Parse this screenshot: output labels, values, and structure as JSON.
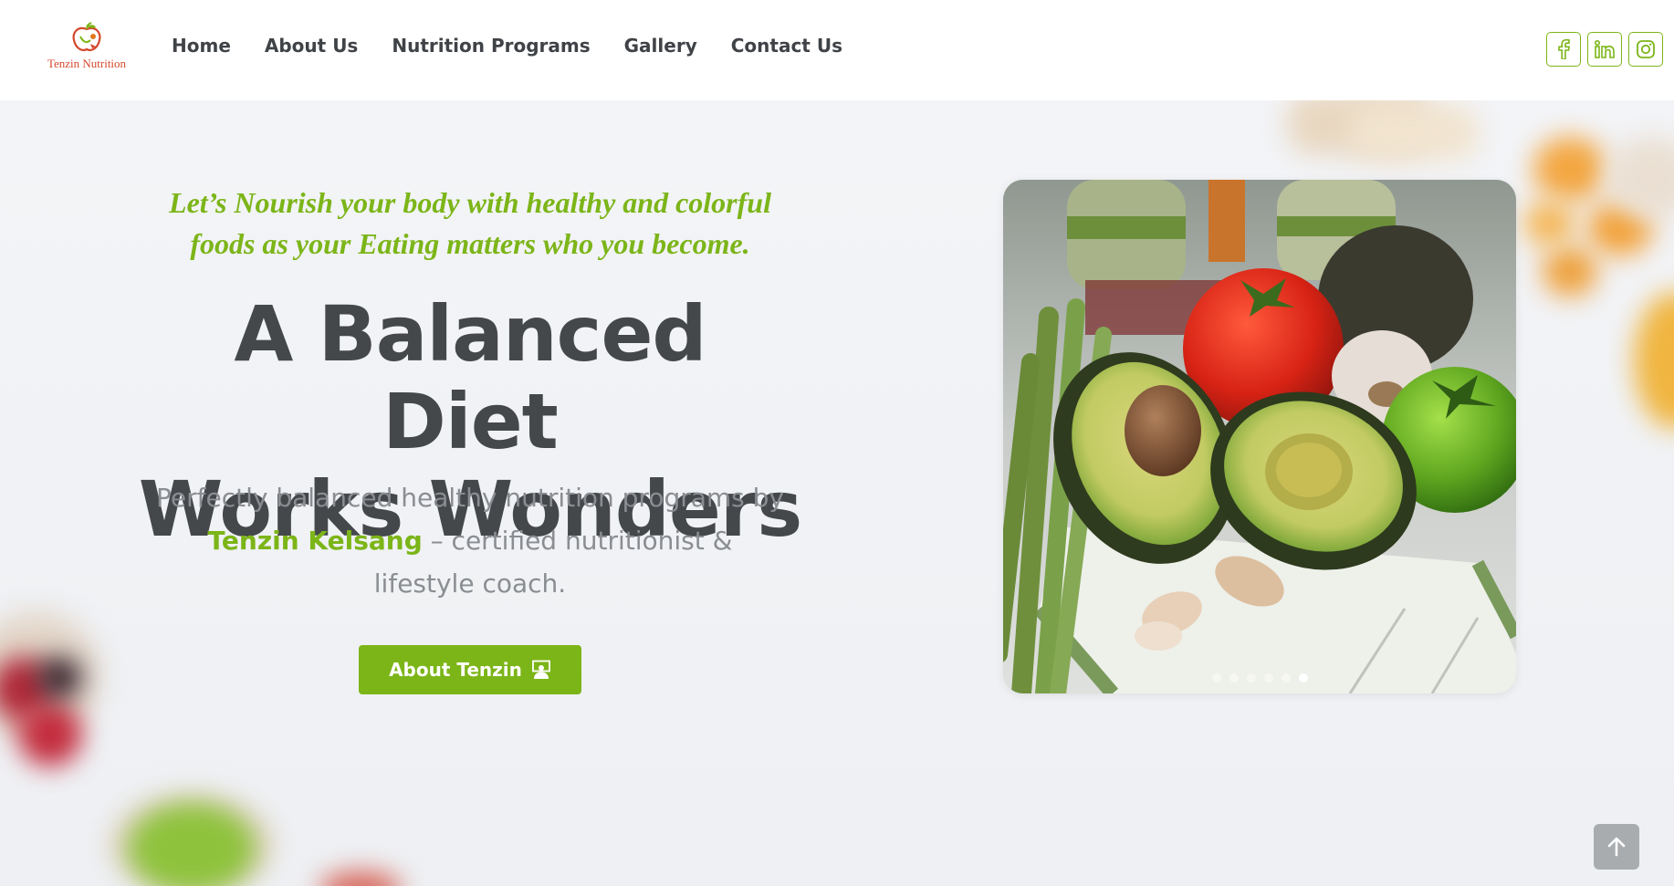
{
  "brand": {
    "name": "Tenzin Nutrition",
    "color": "#7cb518"
  },
  "nav": {
    "items": [
      {
        "label": "Home"
      },
      {
        "label": "About Us"
      },
      {
        "label": "Nutrition Programs"
      },
      {
        "label": "Gallery"
      },
      {
        "label": "Contact Us"
      }
    ]
  },
  "social": {
    "items": [
      {
        "icon": "facebook-icon"
      },
      {
        "icon": "linkedin-icon"
      },
      {
        "icon": "instagram-icon"
      }
    ]
  },
  "hero": {
    "tagline": "Let’s Nourish your body with healthy and colorful foods as your Eating matters who you become.",
    "headline_line1": "A Balanced Diet",
    "headline_line2": "Works Wonders",
    "desc_before": "Perfectly balanced healthy nutrition programs by ",
    "desc_name": "Tenzin Kelsang",
    "desc_after": " – certified nutritionist & lifestyle coach.",
    "cta_label": "About Tenzin",
    "cta_icon": "teacher-icon"
  },
  "carousel": {
    "slide_count": 6,
    "active_index": 5,
    "image_subject": "avocados, tomatoes, garlic and asparagus on a cloth"
  },
  "scroll_top": {
    "icon": "arrow-up-icon"
  }
}
